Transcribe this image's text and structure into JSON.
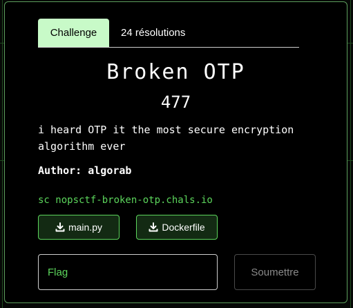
{
  "tabs": {
    "challenge": "Challenge",
    "solves": "24 résolutions"
  },
  "challenge": {
    "name": "Broken OTP",
    "points": "477",
    "description": "i heard OTP it the most secure encryption algorithm ever",
    "author": "Author: algorab",
    "connection": "sc nopsctf-broken-otp.chals.io"
  },
  "files": [
    {
      "label": "main.py",
      "icon": "download-icon"
    },
    {
      "label": "Dockerfile",
      "icon": "download-icon"
    }
  ],
  "submission": {
    "placeholder": "Flag",
    "submit_label": "Soumettre"
  },
  "colors": {
    "accent_green": "#5cd65c",
    "active_tab_bg": "#c8fac8",
    "modal_border": "#5d9e5d"
  }
}
